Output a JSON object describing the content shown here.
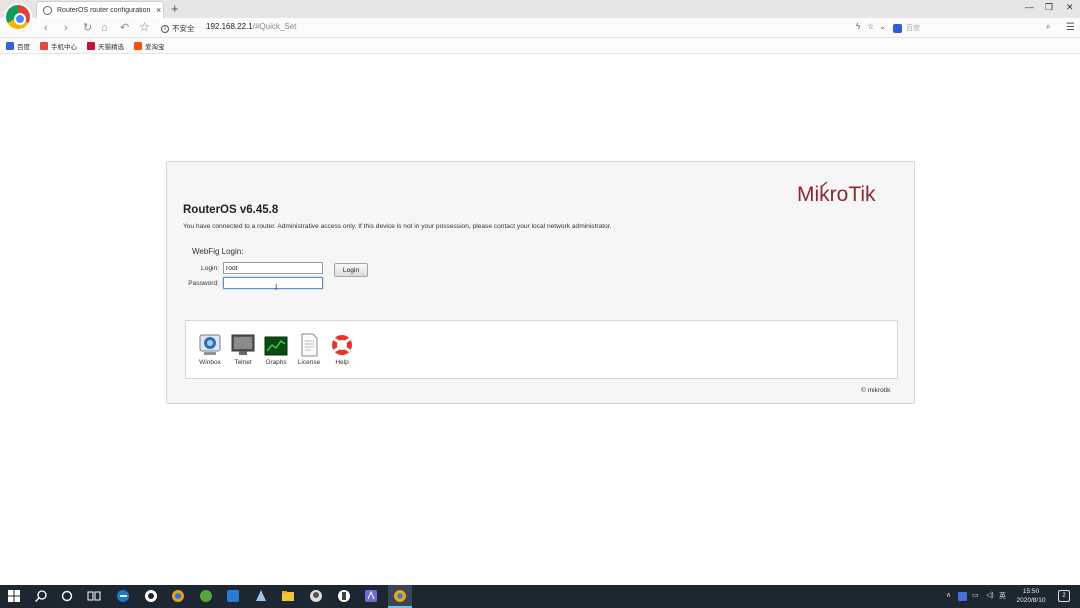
{
  "browser": {
    "tab_title": "RouterOS router configuration",
    "tab_close": "×",
    "new_tab": "+",
    "security_label": "不安全",
    "url_host": "192.168.22.1",
    "url_path": "/#Quick_Set",
    "search_placeholder": "百度",
    "bookmarks": [
      {
        "label": "百度",
        "color": "#3066d6"
      },
      {
        "label": "手机中心",
        "color": "#e04a3a"
      },
      {
        "label": "天猫精选",
        "color": "#c8102e"
      },
      {
        "label": "爱淘宝",
        "color": "#ff5000"
      }
    ],
    "window_controls": {
      "minimize": "—",
      "restore": "❐",
      "close": "✕"
    }
  },
  "page": {
    "title": "RouterOS v6.45.8",
    "notice": "You have connected to a router. Administrative access only. If this device is not in your possession, please contact your local network administrator.",
    "webfig_label": "WebFig Login:",
    "login_label": "Login:",
    "login_value": "root",
    "password_label": "Password:",
    "login_button": "Login",
    "brand": "MikroTik",
    "copyright": "© mikrotik",
    "tools": [
      {
        "label": "Winbox",
        "icon": "winbox-icon"
      },
      {
        "label": "Telnet",
        "icon": "telnet-icon"
      },
      {
        "label": "Graphs",
        "icon": "graphs-icon"
      },
      {
        "label": "License",
        "icon": "license-icon"
      },
      {
        "label": "Help",
        "icon": "help-icon"
      }
    ]
  },
  "taskbar": {
    "tray_lang": "英",
    "time": "15:50",
    "date": "2020/8/10",
    "notifications": "2"
  },
  "colors": {
    "brand_maroon": "#8a2a32",
    "taskbar_bg": "#1d2732",
    "focus_blue": "#5b8fd6"
  }
}
